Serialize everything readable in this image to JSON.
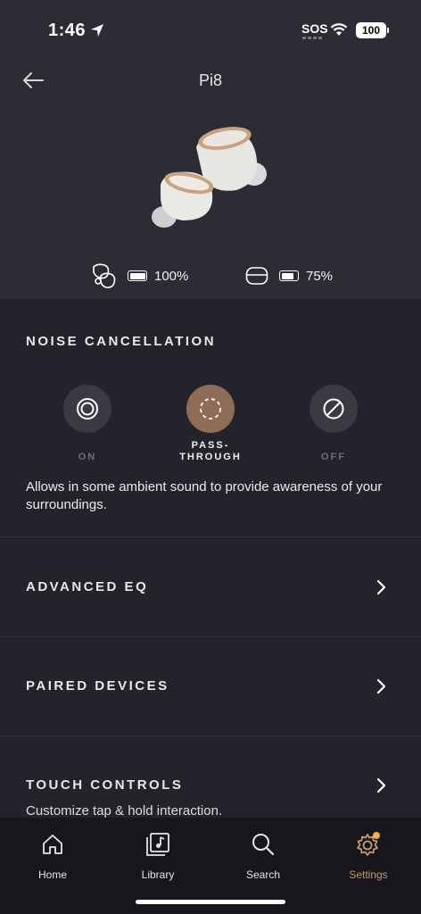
{
  "status_bar": {
    "time": "1:46",
    "sos": "SOS",
    "battery": "100"
  },
  "header": {
    "title": "Pi8"
  },
  "batteries": {
    "earbuds_pct": "100%",
    "case_pct": "75%"
  },
  "noise_cancellation": {
    "title": "NOISE CANCELLATION",
    "options": [
      {
        "label": "ON"
      },
      {
        "label": "PASS-\nTHROUGH",
        "selected": true
      },
      {
        "label": "OFF"
      }
    ],
    "description": "Allows in some ambient sound to provide awareness of your surroundings."
  },
  "menu": [
    {
      "title": "ADVANCED EQ"
    },
    {
      "title": "PAIRED DEVICES"
    },
    {
      "title": "TOUCH CONTROLS",
      "subtitle": "Customize tap & hold interaction."
    }
  ],
  "tabbar": {
    "tabs": [
      {
        "label": "Home",
        "icon": "home-icon"
      },
      {
        "label": "Library",
        "icon": "library-icon"
      },
      {
        "label": "Search",
        "icon": "search-icon"
      },
      {
        "label": "Settings",
        "icon": "gear-icon",
        "active": true
      }
    ]
  },
  "colors": {
    "accent": "#c29a72",
    "selected_mode": "#8f6c55",
    "background": "#23232b"
  }
}
